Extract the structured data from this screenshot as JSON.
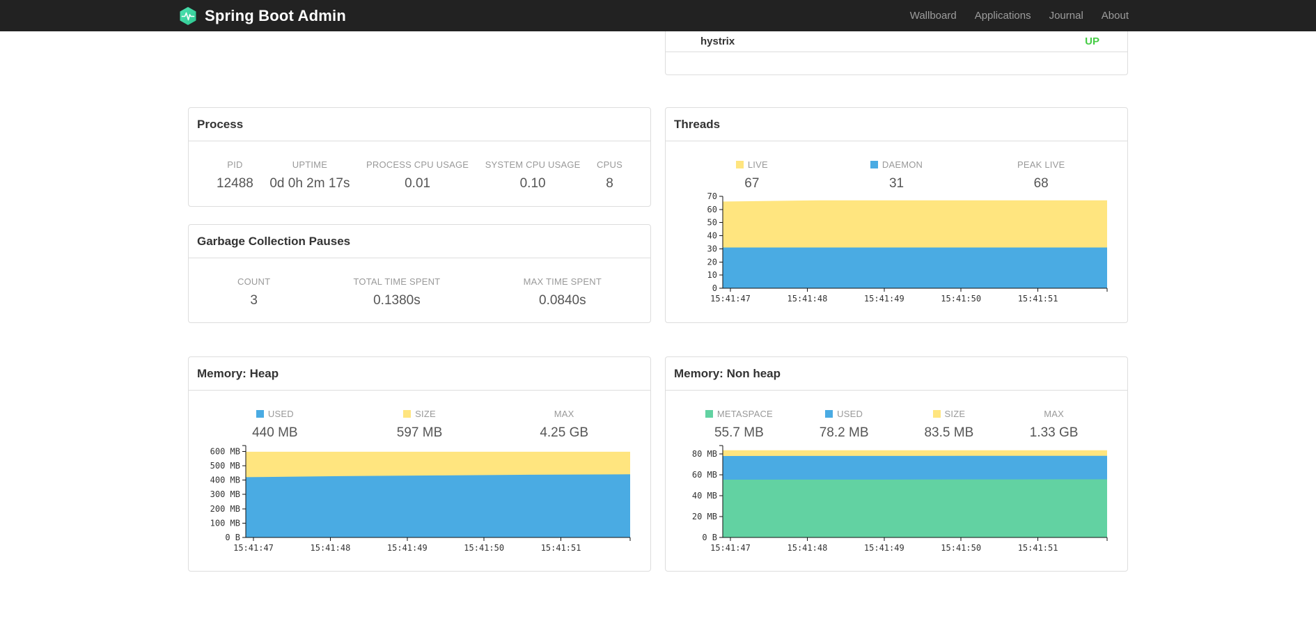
{
  "navbar": {
    "brand": "Spring Boot Admin",
    "items": [
      {
        "label": "Wallboard"
      },
      {
        "label": "Applications"
      },
      {
        "label": "Journal"
      },
      {
        "label": "About"
      }
    ]
  },
  "application": {
    "name": "hystrix",
    "status": "UP",
    "status_color": "#44cc44"
  },
  "cards": {
    "process": {
      "title": "Process",
      "stats": [
        {
          "label": "PID",
          "value": "12488"
        },
        {
          "label": "UPTIME",
          "value": "0d 0h 2m 17s"
        },
        {
          "label": "PROCESS CPU USAGE",
          "value": "0.01"
        },
        {
          "label": "SYSTEM CPU USAGE",
          "value": "0.10"
        },
        {
          "label": "CPUS",
          "value": "8"
        }
      ]
    },
    "gc": {
      "title": "Garbage Collection Pauses",
      "stats": [
        {
          "label": "COUNT",
          "value": "3"
        },
        {
          "label": "TOTAL TIME SPENT",
          "value": "0.1380s"
        },
        {
          "label": "MAX TIME SPENT",
          "value": "0.0840s"
        }
      ]
    },
    "threads": {
      "title": "Threads",
      "stats": [
        {
          "label": "LIVE",
          "value": "67",
          "color": "#ffe57f"
        },
        {
          "label": "DAEMON",
          "value": "31",
          "color": "#4aabe3"
        },
        {
          "label": "PEAK LIVE",
          "value": "68",
          "color": null
        }
      ]
    },
    "memory_heap": {
      "title": "Memory: Heap",
      "stats": [
        {
          "label": "USED",
          "value": "440 MB",
          "color": "#4aabe3"
        },
        {
          "label": "SIZE",
          "value": "597 MB",
          "color": "#ffe57f"
        },
        {
          "label": "MAX",
          "value": "4.25 GB",
          "color": null
        }
      ]
    },
    "memory_nonheap": {
      "title": "Memory: Non heap",
      "stats": [
        {
          "label": "METASPACE",
          "value": "55.7 MB",
          "color": "#62d2a2"
        },
        {
          "label": "USED",
          "value": "78.2 MB",
          "color": "#4aabe3"
        },
        {
          "label": "SIZE",
          "value": "83.5 MB",
          "color": "#ffe57f"
        },
        {
          "label": "MAX",
          "value": "1.33 GB",
          "color": null
        }
      ]
    }
  },
  "chart_data": [
    {
      "id": "threads",
      "type": "area",
      "title": "Threads",
      "x": [
        "15:41:47",
        "15:41:48",
        "15:41:49",
        "15:41:50",
        "15:41:51"
      ],
      "ymax": 70,
      "ytick_values": [
        0,
        10,
        20,
        30,
        40,
        50,
        60,
        70
      ],
      "ytick_labels": [
        "0",
        "10",
        "20",
        "30",
        "40",
        "50",
        "60",
        "70"
      ],
      "series": [
        {
          "name": "LIVE",
          "color": "#ffe57f",
          "values": [
            66,
            67,
            67,
            67,
            67
          ]
        },
        {
          "name": "DAEMON",
          "color": "#4aabe3",
          "values": [
            31,
            31,
            31,
            31,
            31
          ]
        }
      ]
    },
    {
      "id": "memory_heap",
      "type": "area",
      "title": "Memory: Heap",
      "x": [
        "15:41:47",
        "15:41:48",
        "15:41:49",
        "15:41:50",
        "15:41:51"
      ],
      "ymax": 640,
      "ytick_values": [
        0,
        100,
        200,
        300,
        400,
        500,
        600
      ],
      "ytick_labels": [
        "0 B",
        "100 MB",
        "200 MB",
        "300 MB",
        "400 MB",
        "500 MB",
        "600 MB"
      ],
      "series": [
        {
          "name": "SIZE",
          "color": "#ffe57f",
          "values": [
            597,
            597,
            597,
            597,
            597
          ]
        },
        {
          "name": "USED",
          "color": "#4aabe3",
          "values": [
            420,
            427,
            432,
            437,
            440
          ]
        }
      ]
    },
    {
      "id": "memory_nonheap",
      "type": "area",
      "title": "Memory: Non heap",
      "x": [
        "15:41:47",
        "15:41:48",
        "15:41:49",
        "15:41:50",
        "15:41:51"
      ],
      "ymax": 88,
      "ytick_values": [
        0,
        20,
        40,
        60,
        80
      ],
      "ytick_labels": [
        "0 B",
        "20 MB",
        "40 MB",
        "60 MB",
        "80 MB"
      ],
      "series": [
        {
          "name": "SIZE",
          "color": "#ffe57f",
          "values": [
            83.5,
            83.5,
            83.5,
            83.5,
            83.5
          ]
        },
        {
          "name": "USED",
          "color": "#4aabe3",
          "values": [
            78.0,
            78.1,
            78.1,
            78.2,
            78.2
          ]
        },
        {
          "name": "METASPACE",
          "color": "#62d2a2",
          "values": [
            55.3,
            55.4,
            55.5,
            55.6,
            55.7
          ]
        }
      ]
    }
  ]
}
